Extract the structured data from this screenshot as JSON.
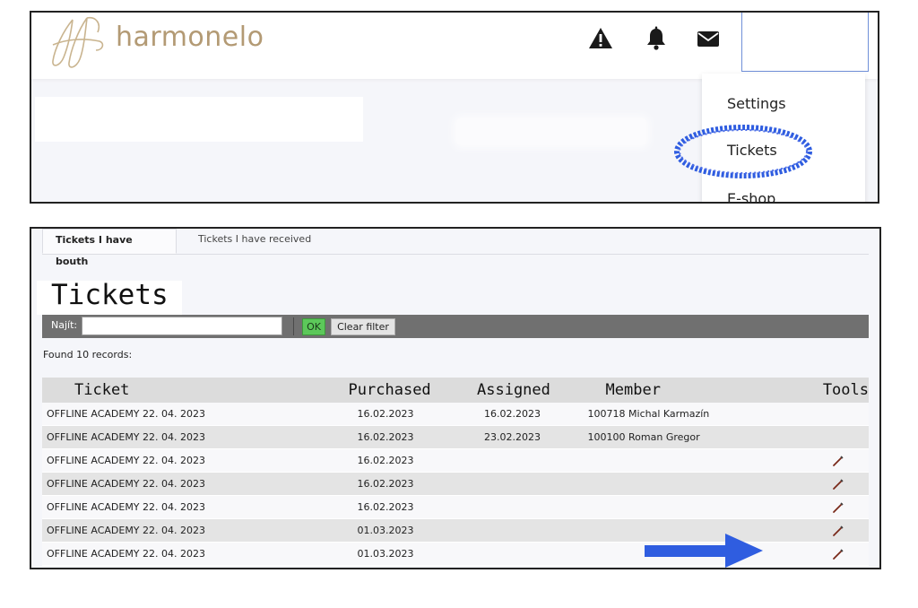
{
  "header": {
    "brand_name": "harmonelo",
    "icons": [
      "warning-icon",
      "bell-icon",
      "mail-icon"
    ],
    "brand_color": "#b39a74"
  },
  "dropdown": {
    "items": [
      {
        "label": "Settings"
      },
      {
        "label": "Tickets"
      },
      {
        "label": "E-shop"
      }
    ]
  },
  "tabs": [
    {
      "label": "Tickets I have bouth",
      "active": true
    },
    {
      "label": "Tickets I have received",
      "active": false
    }
  ],
  "page_title": "Tickets",
  "filter": {
    "label": "Najít:",
    "value": "",
    "ok_label": "OK",
    "clear_label": "Clear filter"
  },
  "found_text": "Found 10 records:",
  "table": {
    "columns": [
      "Ticket",
      "Purchased",
      "Assigned",
      "Member",
      "Tools"
    ],
    "rows": [
      {
        "ticket": "OFFLINE ACADEMY 22. 04. 2023",
        "purchased": "16.02.2023",
        "assigned": "16.02.2023",
        "member": "100718 Michal Karmazín",
        "tools": false
      },
      {
        "ticket": "OFFLINE ACADEMY 22. 04. 2023",
        "purchased": "16.02.2023",
        "assigned": "23.02.2023",
        "member": "100100 Roman Gregor",
        "tools": false
      },
      {
        "ticket": "OFFLINE ACADEMY 22. 04. 2023",
        "purchased": "16.02.2023",
        "assigned": "",
        "member": "",
        "tools": true
      },
      {
        "ticket": "OFFLINE ACADEMY 22. 04. 2023",
        "purchased": "16.02.2023",
        "assigned": "",
        "member": "",
        "tools": true
      },
      {
        "ticket": "OFFLINE ACADEMY 22. 04. 2023",
        "purchased": "16.02.2023",
        "assigned": "",
        "member": "",
        "tools": true
      },
      {
        "ticket": "OFFLINE ACADEMY 22. 04. 2023",
        "purchased": "01.03.2023",
        "assigned": "",
        "member": "",
        "tools": true
      },
      {
        "ticket": "OFFLINE ACADEMY 22. 04. 2023",
        "purchased": "01.03.2023",
        "assigned": "",
        "member": "",
        "tools": true
      }
    ]
  },
  "colors": {
    "ok_button": "#5cc85a",
    "filter_bar": "#707070",
    "annotation": "#2f5de0"
  }
}
